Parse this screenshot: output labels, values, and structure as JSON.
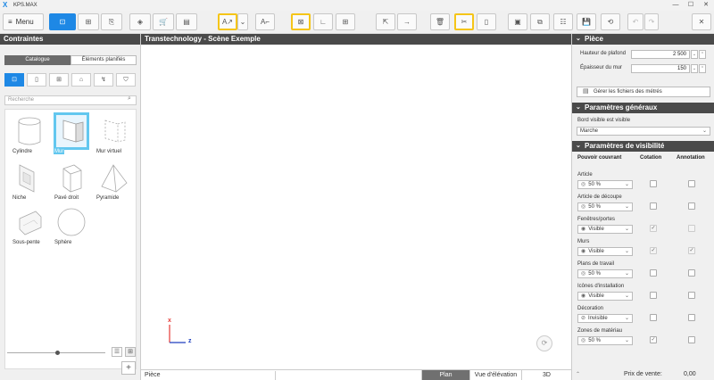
{
  "titlebar": {
    "app_name": "KPS.MAX",
    "minimize": "—",
    "maximize": "☐",
    "close": "✕"
  },
  "toolbar": {
    "menu_label": "Menu",
    "buttons": [
      {
        "name": "walls-tool-button",
        "glyph": "⊡"
      },
      {
        "name": "grid-tool-button",
        "glyph": "⊞"
      },
      {
        "name": "catalog-tool-button",
        "glyph": "⎘"
      },
      {
        "name": "design-tool-button",
        "glyph": "◈"
      },
      {
        "name": "cart-tool-button",
        "glyph": "🛒"
      },
      {
        "name": "document-tool-button",
        "glyph": "▤"
      },
      {
        "name": "auto-dimension-button",
        "glyph": "A↗"
      },
      {
        "name": "auto-dimension-dropdown-button",
        "glyph": "⌄"
      },
      {
        "name": "dimension-tool-button",
        "glyph": "A⌐"
      },
      {
        "name": "snap-tool-button",
        "glyph": "⊠"
      },
      {
        "name": "measure-tool-button",
        "glyph": "∟"
      },
      {
        "name": "add-tool-button",
        "glyph": "⊞"
      },
      {
        "name": "import-button",
        "glyph": "⇱"
      },
      {
        "name": "export-button",
        "glyph": "→"
      },
      {
        "name": "delete-button",
        "glyph": "🗑"
      },
      {
        "name": "cut-tool-button",
        "glyph": "✂"
      },
      {
        "name": "measure-bar-button",
        "glyph": "▯"
      },
      {
        "name": "presentation-button",
        "glyph": "▣"
      },
      {
        "name": "layers-button",
        "glyph": "⧉"
      },
      {
        "name": "checklist-button",
        "glyph": "☷"
      },
      {
        "name": "save-button",
        "glyph": "💾"
      },
      {
        "name": "refresh-button",
        "glyph": "⟲"
      },
      {
        "name": "undo-button",
        "glyph": "↶"
      },
      {
        "name": "redo-button",
        "glyph": "↷"
      },
      {
        "name": "close-project-button",
        "glyph": "✕"
      }
    ]
  },
  "left": {
    "title": "Contraintes",
    "tab_catalogue": "Catalogue",
    "tab_planned": "Éléments planifiés",
    "categories": [
      "⊡",
      "▯",
      "⊞",
      "⌂",
      "↯",
      "⛉"
    ],
    "search_placeholder": "Recherche",
    "items": [
      {
        "label": "Cylindre"
      },
      {
        "label": "Mur"
      },
      {
        "label": "Mur virtuel"
      },
      {
        "label": "Niche"
      },
      {
        "label": "Pavé droit"
      },
      {
        "label": "Pyramide"
      },
      {
        "label": "Sous-pente"
      },
      {
        "label": "Sphère"
      }
    ],
    "view_list": "☰",
    "view_grid": "⊞",
    "add": "+"
  },
  "center": {
    "title": "Transtechnology - Scène Exemple",
    "axis_x": "x",
    "axis_z": "z",
    "level": "Pièce",
    "view_tabs": [
      "Plan",
      "Vue d'élévation",
      "3D"
    ]
  },
  "right": {
    "piece_title": "Pièce",
    "ceiling_label": "Hauteur de plafond",
    "ceiling_value": "2 500",
    "wall_label": "Épaisseur du mur",
    "wall_value": "150",
    "manage_label": "Gérer les fichiers des métrés",
    "general_title": "Paramètres généraux",
    "edge_label": "Bord visible est visible",
    "edge_value": "Marche",
    "visibility_title": "Paramètres de visibilité",
    "col_cover": "Pouvoir couvrant",
    "col_dimension": "Cotation",
    "col_annotation": "Annotation",
    "rows": [
      {
        "label": "Article",
        "value": "50 %",
        "icon": "◎",
        "dim_checked": false,
        "ann_checked": false,
        "disabled": false
      },
      {
        "label": "Article de découpe",
        "value": "50 %",
        "icon": "◎",
        "dim_checked": false,
        "ann_checked": false,
        "disabled": false
      },
      {
        "label": "Fenêtres/portes",
        "value": "Visible",
        "icon": "◉",
        "dim_checked": true,
        "ann_checked": false,
        "disabled": true
      },
      {
        "label": "Murs",
        "value": "Visible",
        "icon": "◉",
        "dim_checked": true,
        "ann_checked": true,
        "disabled": true
      },
      {
        "label": "Plans de travail",
        "value": "50 %",
        "icon": "◎",
        "dim_checked": false,
        "ann_checked": false,
        "disabled": false
      },
      {
        "label": "Icônes d'installation",
        "value": "Visible",
        "icon": "◉",
        "dim_checked": false,
        "ann_checked": false,
        "disabled": false
      },
      {
        "label": "Décoration",
        "value": "Invisible",
        "icon": "⊘",
        "dim_checked": false,
        "ann_checked": false,
        "disabled": false
      },
      {
        "label": "Zones de matériau",
        "value": "50 %",
        "icon": "◎",
        "dim_checked": true,
        "ann_checked": false,
        "disabled": false
      }
    ],
    "price_label": "Prix de vente:",
    "price_value": "0,00"
  }
}
